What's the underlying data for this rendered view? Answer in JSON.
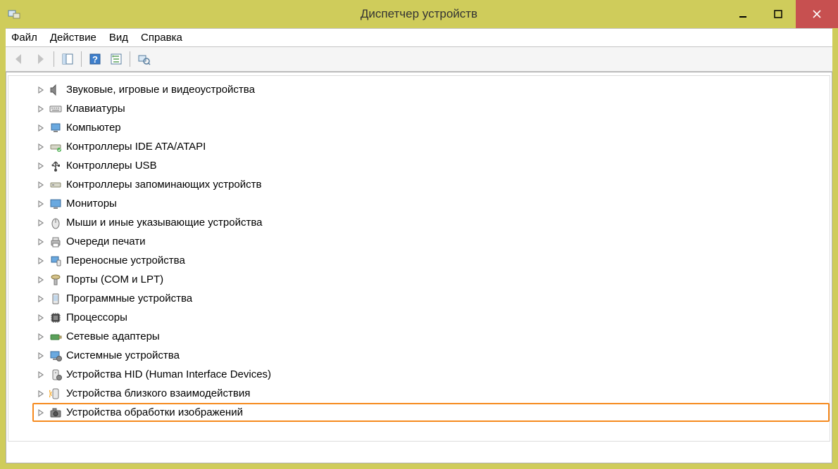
{
  "window": {
    "title": "Диспетчер устройств"
  },
  "menu": {
    "file": "Файл",
    "action": "Действие",
    "view": "Вид",
    "help": "Справка"
  },
  "toolbar": {
    "back": "back",
    "forward": "forward",
    "show_hide": "show-hide",
    "help": "help",
    "refresh": "refresh",
    "scan": "scan"
  },
  "tree": {
    "items": [
      {
        "label": "Звуковые, игровые и видеоустройства",
        "icon": "sound-icon",
        "highlighted": false
      },
      {
        "label": "Клавиатуры",
        "icon": "keyboard-icon",
        "highlighted": false
      },
      {
        "label": "Компьютер",
        "icon": "computer-icon",
        "highlighted": false
      },
      {
        "label": "Контроллеры IDE ATA/ATAPI",
        "icon": "ide-controller-icon",
        "highlighted": false
      },
      {
        "label": "Контроллеры USB",
        "icon": "usb-icon",
        "highlighted": false
      },
      {
        "label": "Контроллеры запоминающих устройств",
        "icon": "storage-controller-icon",
        "highlighted": false
      },
      {
        "label": "Мониторы",
        "icon": "monitor-icon",
        "highlighted": false
      },
      {
        "label": "Мыши и иные указывающие устройства",
        "icon": "mouse-icon",
        "highlighted": false
      },
      {
        "label": "Очереди печати",
        "icon": "printer-icon",
        "highlighted": false
      },
      {
        "label": "Переносные устройства",
        "icon": "portable-device-icon",
        "highlighted": false
      },
      {
        "label": "Порты (COM и LPT)",
        "icon": "port-icon",
        "highlighted": false
      },
      {
        "label": "Программные устройства",
        "icon": "software-device-icon",
        "highlighted": false
      },
      {
        "label": "Процессоры",
        "icon": "processor-icon",
        "highlighted": false
      },
      {
        "label": "Сетевые адаптеры",
        "icon": "network-adapter-icon",
        "highlighted": false
      },
      {
        "label": "Системные устройства",
        "icon": "system-device-icon",
        "highlighted": false
      },
      {
        "label": "Устройства HID (Human Interface Devices)",
        "icon": "hid-icon",
        "highlighted": false
      },
      {
        "label": "Устройства близкого взаимодействия",
        "icon": "nfc-icon",
        "highlighted": false
      },
      {
        "label": "Устройства обработки изображений",
        "icon": "imaging-device-icon",
        "highlighted": true
      }
    ]
  }
}
